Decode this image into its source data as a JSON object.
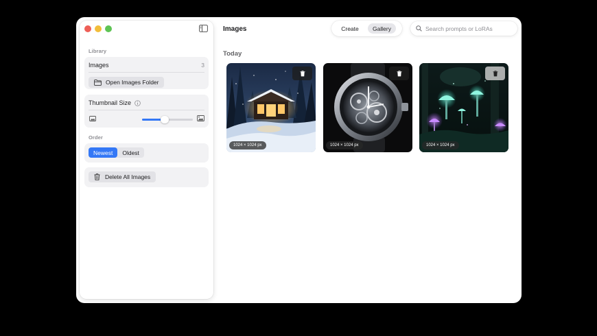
{
  "window": {
    "title": "Images",
    "modes": [
      "Create",
      "Gallery"
    ],
    "active_mode": "Gallery",
    "search_placeholder": "Search prompts or LoRAs"
  },
  "sidebar": {
    "library_label": "Library",
    "images_label": "Images",
    "images_count": "3",
    "open_folder_label": "Open Images Folder",
    "thumbnail_size_label": "Thumbnail Size",
    "thumbnail_size_value": 0.44,
    "order_label": "Order",
    "order_options": [
      "Newest",
      "Oldest"
    ],
    "order_selected": "Newest",
    "delete_all_label": "Delete All Images"
  },
  "gallery": {
    "group_label": "Today",
    "items": [
      {
        "subject": "snowy forest cabin at night",
        "dimensions": "1024 × 1024 px"
      },
      {
        "subject": "skeleton wristwatch",
        "dimensions": "1024 × 1024 px"
      },
      {
        "subject": "glowing mushroom forest",
        "dimensions": "1024 × 1024 px"
      }
    ]
  },
  "colors": {
    "accent": "#3478f6",
    "traffic_red": "#ee5f57",
    "traffic_yellow": "#f2bd3b",
    "traffic_green": "#5ec454"
  }
}
